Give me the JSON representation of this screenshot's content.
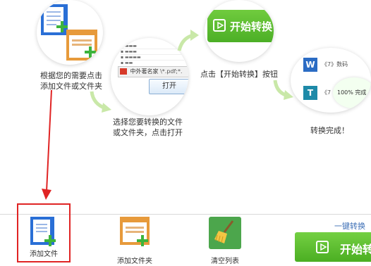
{
  "steps": {
    "step1_caption_line1": "根据您的需要点击",
    "step1_caption_line2": "添加文件或文件夹",
    "step2_caption_line1": "选择您要转换的文件",
    "step2_caption_line2": "或文件夹，点击打开",
    "step2_filename": "中外著名家",
    "step2_filter": "\\*.pdf;*.",
    "step2_open_button": "打开",
    "step3_button_label": "开始转换",
    "step3_caption": "点击【开始转换】按钮",
    "step4_item1": "《7》数码",
    "step4_item2": "《7",
    "step4_progress": "100%",
    "step4_progress_suffix": "完成",
    "step4_caption": "转换完成！"
  },
  "toolbar": {
    "add_file_label": "添加文件",
    "add_folder_label": "添加文件夹",
    "clear_list_label": "清空列表",
    "one_click_label": "一键转换",
    "start_button_label": "开始转"
  },
  "colors": {
    "accent_green": "#5bbb2f",
    "highlight_red": "#e02424",
    "doc_blue": "#2a6fd6",
    "folder_orange": "#e79a3b"
  }
}
